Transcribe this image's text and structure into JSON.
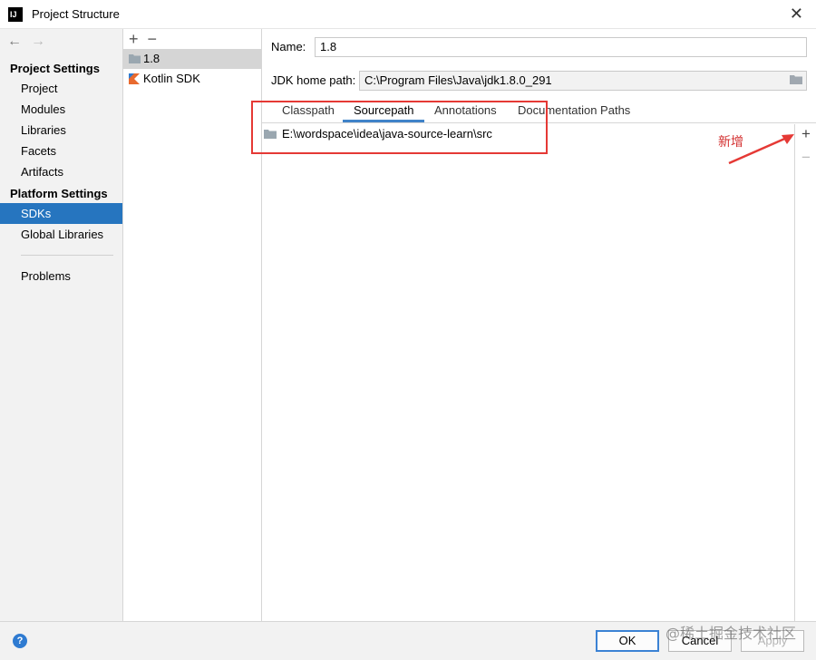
{
  "window": {
    "title": "Project Structure"
  },
  "sidebar": {
    "project_settings_header": "Project Settings",
    "project_items": [
      "Project",
      "Modules",
      "Libraries",
      "Facets",
      "Artifacts"
    ],
    "platform_settings_header": "Platform Settings",
    "platform_items": [
      "SDKs",
      "Global Libraries"
    ],
    "other_items": [
      "Problems"
    ],
    "selected": "SDKs"
  },
  "sdk_list": {
    "items": [
      {
        "label": "1.8",
        "icon": "folder-icon"
      },
      {
        "label": "Kotlin SDK",
        "icon": "kotlin-icon"
      }
    ],
    "selected": "1.8"
  },
  "form": {
    "name_label": "Name:",
    "name_value": "1.8",
    "home_label": "JDK home path:",
    "home_value": "C:\\Program Files\\Java\\jdk1.8.0_291"
  },
  "tabs": {
    "items": [
      "Classpath",
      "Sourcepath",
      "Annotations",
      "Documentation Paths"
    ],
    "selected": "Sourcepath"
  },
  "sourcepath": {
    "entries": [
      "E:\\wordspace\\idea\\java-source-learn\\src"
    ]
  },
  "annotation": {
    "text": "新增",
    "color": "#e53935"
  },
  "footer": {
    "help": "?",
    "ok": "OK",
    "cancel": "Cancel",
    "apply": "Apply",
    "watermark": "@稀土掘金技术社区"
  },
  "colors": {
    "accent": "#2675bf",
    "tab_underline": "#4083c9",
    "selection_gray": "#d5d5d5"
  }
}
